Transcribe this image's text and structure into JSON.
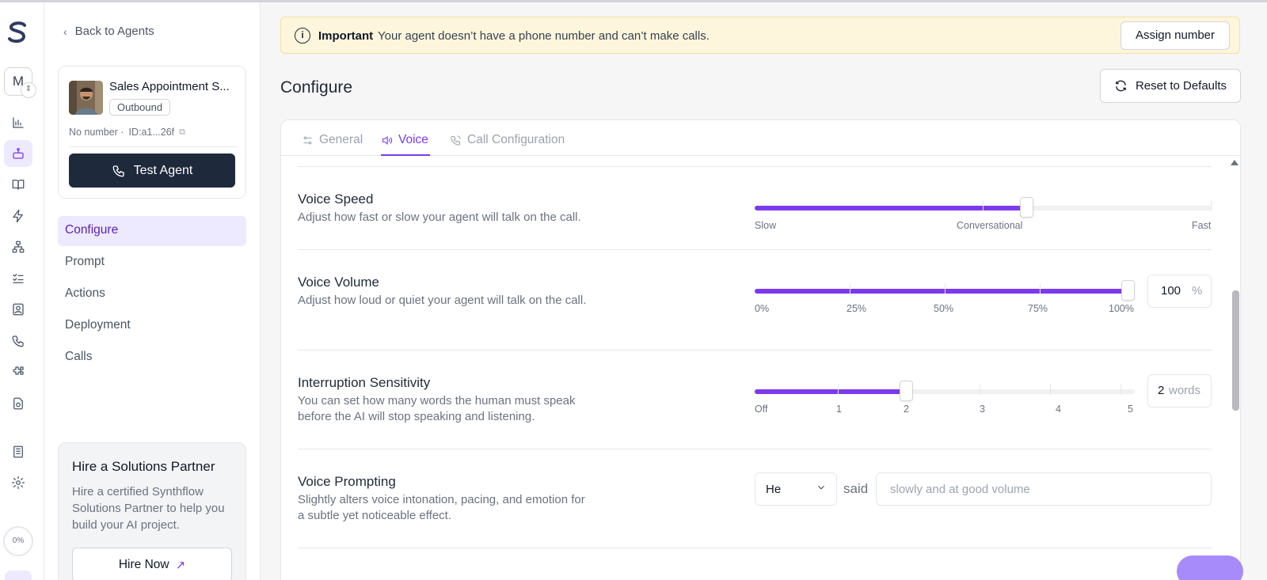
{
  "rail": {
    "workspace_initial": "M",
    "progress_label": "0%",
    "icons": [
      "analytics-icon",
      "agents-icon",
      "knowledge-icon",
      "automations-icon",
      "integrations-icon",
      "tasks-icon",
      "contacts-icon",
      "phone-icon",
      "plugins-icon",
      "settings-file-icon",
      "billing-icon",
      "settings-icon"
    ]
  },
  "left": {
    "back_label": "Back to Agents",
    "agent": {
      "name": "Sales Appointment S...",
      "badge": "Outbound",
      "number": "No number ·",
      "id": "ID:a1...26f",
      "test_label": "Test Agent"
    },
    "nav": [
      "Configure",
      "Prompt",
      "Actions",
      "Deployment",
      "Calls"
    ],
    "hire": {
      "title": "Hire a Solutions Partner",
      "desc": "Hire a certified Synthflow Solutions Partner to help you build your AI project.",
      "button": "Hire Now"
    }
  },
  "banner": {
    "strong": "Important",
    "message": "Your agent doesn’t have a phone number and can’t make calls.",
    "action": "Assign number"
  },
  "header": {
    "title": "Configure",
    "reset_label": "Reset to Defaults"
  },
  "tabs": [
    "General",
    "Voice",
    "Call Configuration"
  ],
  "active_tab": "Voice",
  "settings": {
    "speed": {
      "title": "Voice Speed",
      "desc": "Adjust how fast or slow your agent will talk on the call.",
      "labels": [
        "Slow",
        "Conversational",
        "Fast"
      ],
      "value_fraction": 0.595
    },
    "volume": {
      "title": "Voice Volume",
      "desc": "Adjust how loud or quiet your agent will talk on the call.",
      "labels": [
        "0%",
        "25%",
        "50%",
        "75%",
        "100%"
      ],
      "value": "100",
      "unit": "%"
    },
    "interruption": {
      "title": "Interruption Sensitivity",
      "desc": "You can set how many words the human must speak before the AI will stop speaking and listening.",
      "labels": [
        "Off",
        "1",
        "2",
        "3",
        "4",
        "5"
      ],
      "value": "2",
      "unit": "words"
    },
    "prompting": {
      "title": "Voice Prompting",
      "desc": "Slightly alters voice intonation, pacing, and emotion for a subtle yet noticeable effect.",
      "pronoun": "He",
      "said": "said",
      "placeholder": "slowly and at good volume"
    }
  },
  "colors": {
    "accent": "#7c3aed",
    "accent_soft": "#ede9fe",
    "banner_bg": "#fdf6dc",
    "dark_button": "#1e293b"
  }
}
